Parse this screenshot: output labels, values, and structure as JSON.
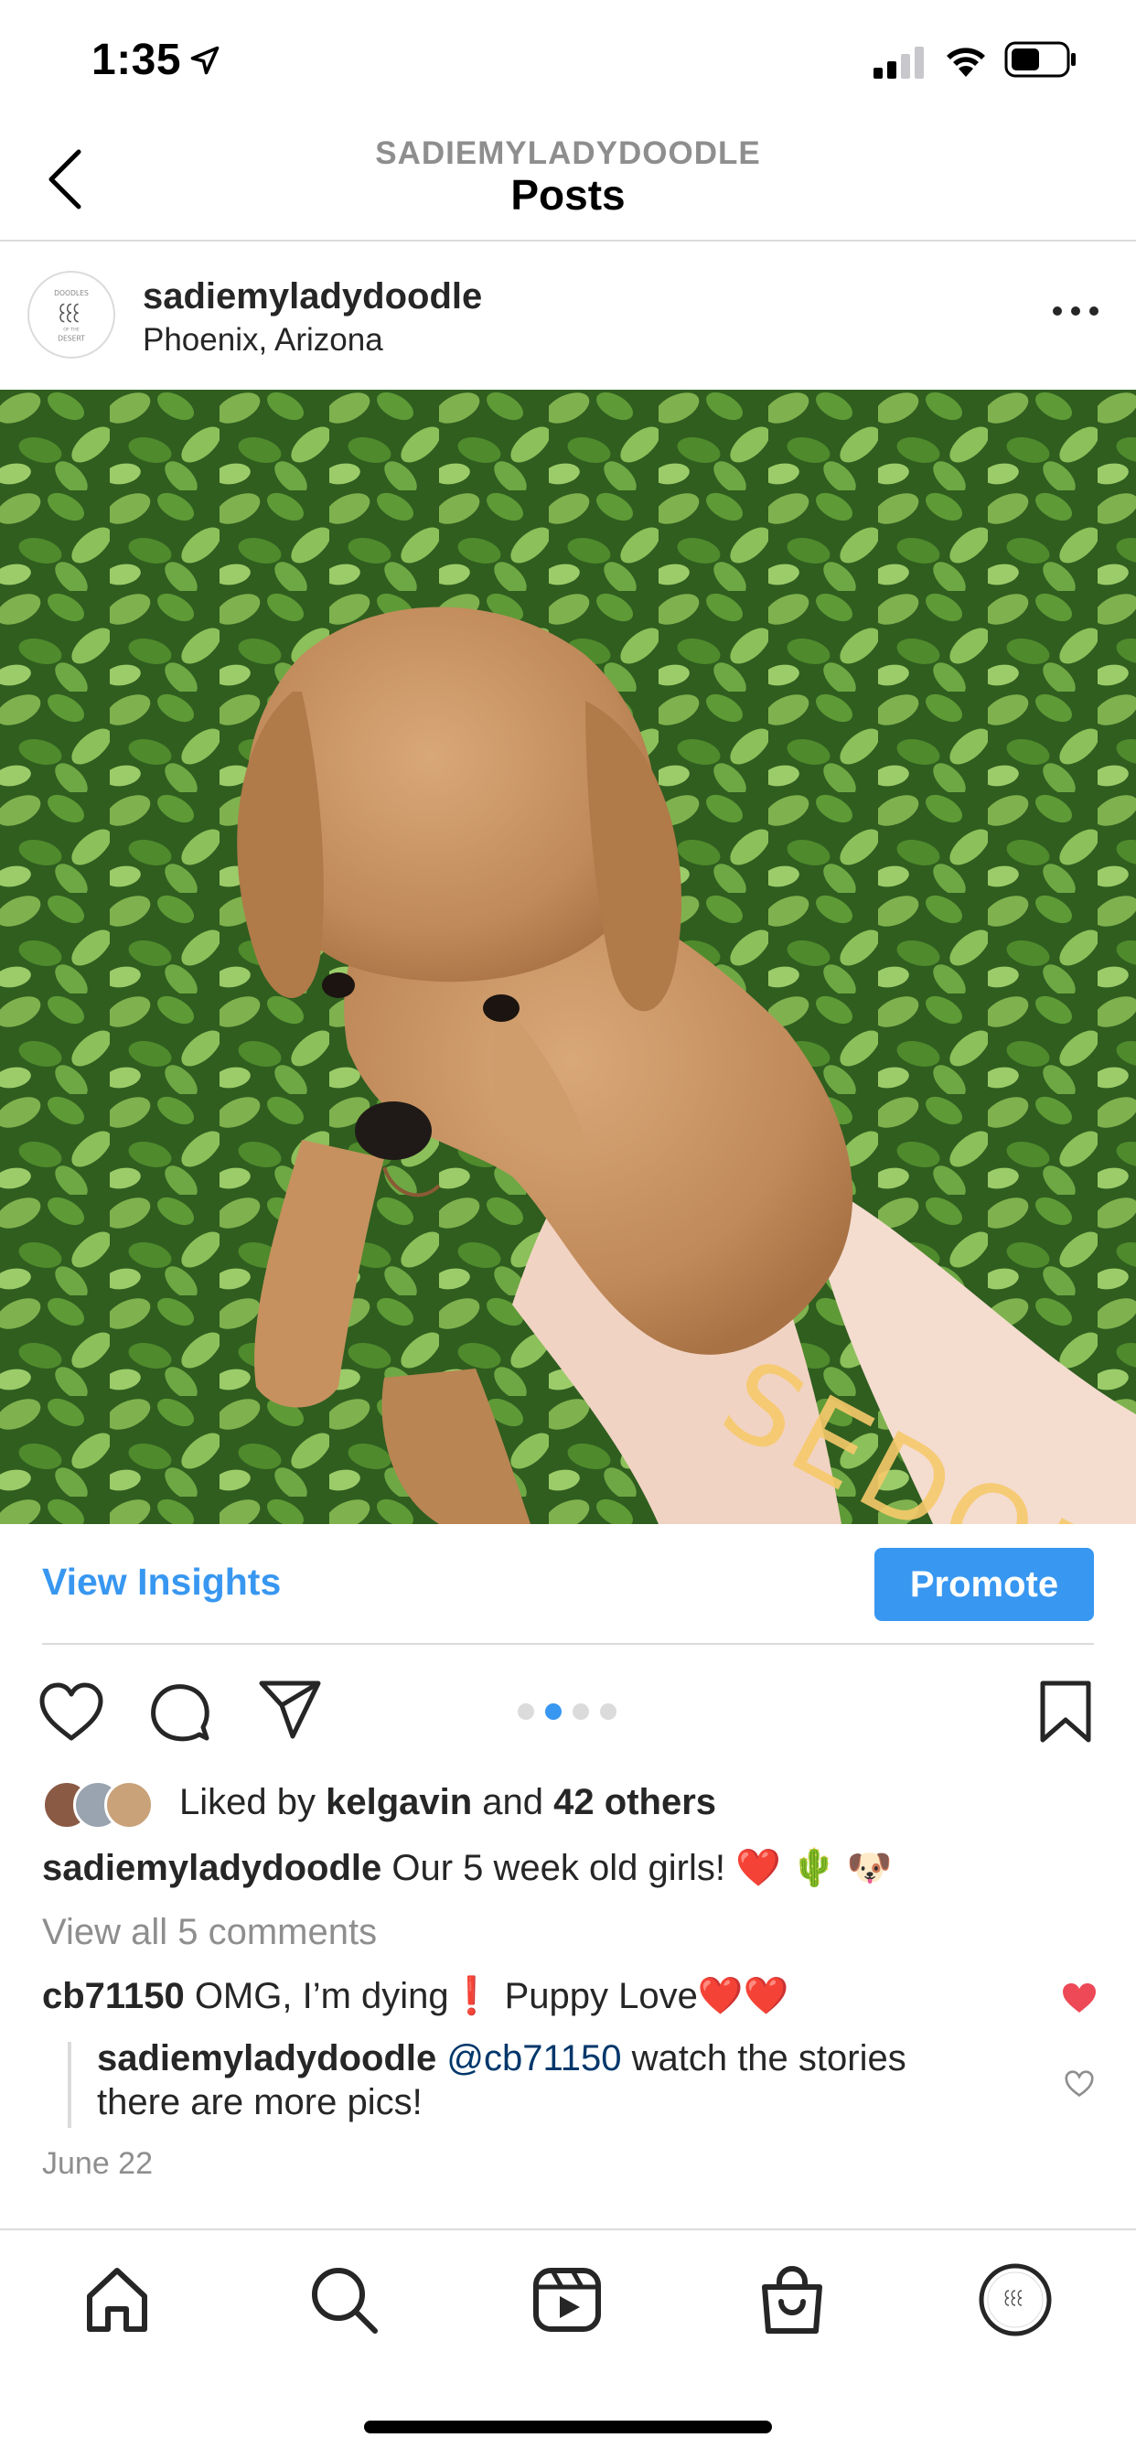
{
  "status_bar": {
    "time": "1:35",
    "icons": [
      "location-arrow-icon",
      "signal-icon",
      "wifi-icon",
      "battery-icon"
    ]
  },
  "nav": {
    "subtitle": "SADIEMYLADYDOODLE",
    "title": "Posts",
    "back_icon": "chevron-left-icon"
  },
  "post": {
    "username": "sadiemyladydoodle",
    "location": "Phoenix, Arizona",
    "avatar_text": [
      "DOODLES",
      "OF THE",
      "DESERT"
    ],
    "photo_overlay_text": "SEDONA",
    "view_insights_label": "View Insights",
    "promote_label": "Promote",
    "carousel": {
      "count": 4,
      "active_index": 1
    },
    "likes": {
      "prefix": "Liked by ",
      "user": "kelgavin",
      "middle": " and ",
      "others": "42 others"
    },
    "caption": {
      "username": "sadiemyladydoodle",
      "text": " Our 5 week old girls! ❤️ 🌵 🐶"
    },
    "view_comments_label": "View all 5 comments",
    "comments": [
      {
        "username": "cb71150",
        "text": " OMG, I’m dying❗ Puppy Love❤️❤️",
        "liked": true
      },
      {
        "username": "sadiemyladydoodle",
        "mention": " @cb71150",
        "text": " watch the stories there are more pics!",
        "liked": false
      }
    ],
    "date": "June 22"
  },
  "tab_bar": {
    "items": [
      "home-icon",
      "search-icon",
      "reels-icon",
      "shop-icon",
      "profile-avatar"
    ]
  },
  "colors": {
    "accent_blue": "#3897f0",
    "liked_red": "#ed4956",
    "secondary_text": "#8e8e8e",
    "divider": "#dbdbdb"
  }
}
